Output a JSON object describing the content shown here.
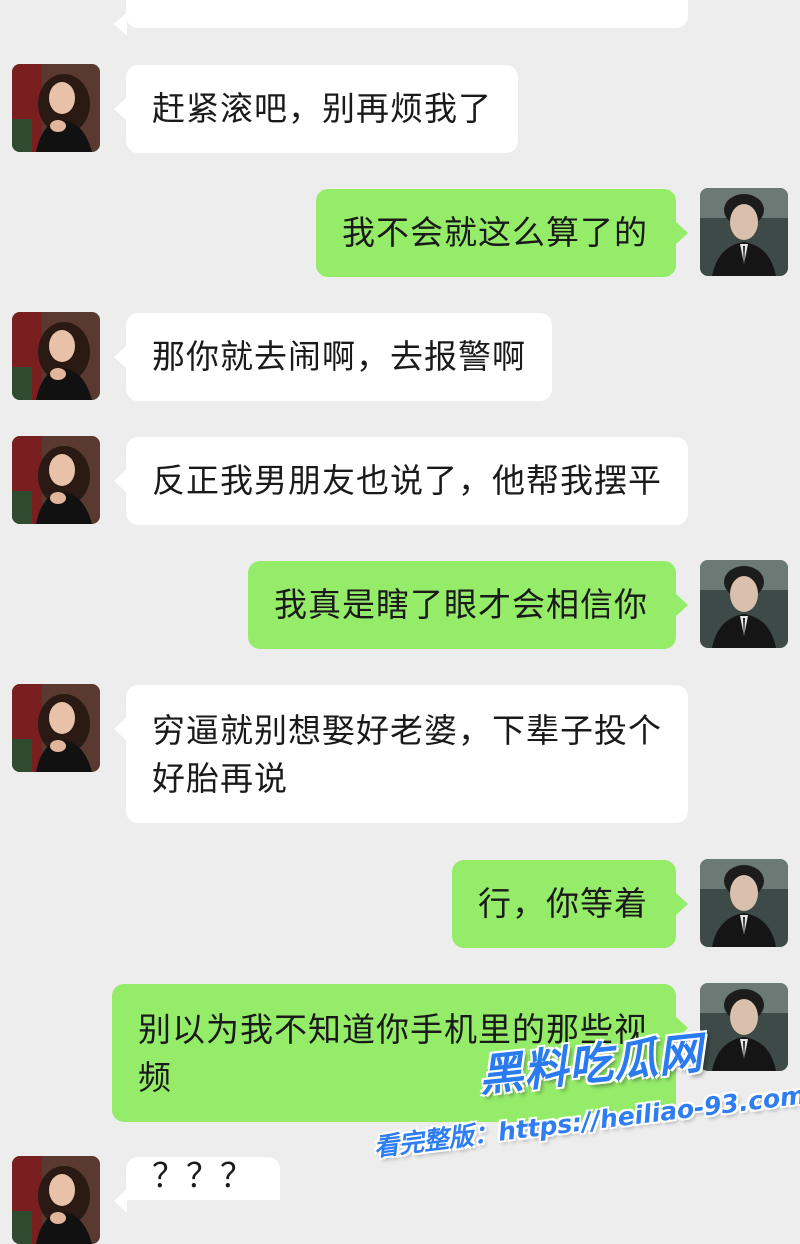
{
  "colors": {
    "background": "#ededed",
    "incoming_bubble": "#ffffff",
    "outgoing_bubble": "#95ec69"
  },
  "messages": [
    {
      "id": "m0",
      "side": "in",
      "text": ""
    },
    {
      "id": "m1",
      "side": "in",
      "text": "赶紧滚吧，别再烦我了"
    },
    {
      "id": "m2",
      "side": "out",
      "text": "我不会就这么算了的"
    },
    {
      "id": "m3",
      "side": "in",
      "text": "那你就去闹啊，去报警啊"
    },
    {
      "id": "m4",
      "side": "in",
      "text": "反正我男朋友也说了，他帮我摆平"
    },
    {
      "id": "m5",
      "side": "out",
      "text": "我真是瞎了眼才会相信你"
    },
    {
      "id": "m6",
      "side": "in",
      "text": "穷逼就别想娶好老婆，下辈子投个好胎再说"
    },
    {
      "id": "m7",
      "side": "out",
      "text": "行，你等着"
    },
    {
      "id": "m8",
      "side": "out",
      "text": "别以为我不知道你手机里的那些视频"
    },
    {
      "id": "m9",
      "side": "in",
      "text": "？？？"
    }
  ],
  "watermark": {
    "brand": "黑料吃瓜网",
    "url": "看完整版：https://heiliao-93.com"
  }
}
